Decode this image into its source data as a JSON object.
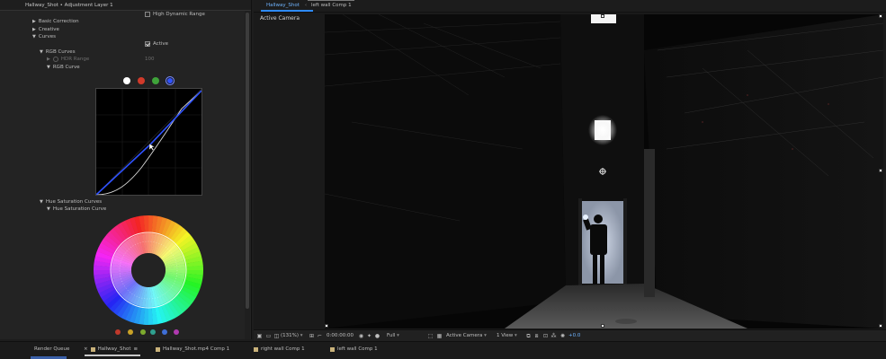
{
  "effect_controls": {
    "title": "Hallway_Shot • Adjustment Layer 1",
    "hdr_label": "High Dynamic Range",
    "basic_correction": "Basic Correction",
    "creative": "Creative",
    "curves": "Curves",
    "active_label": "Active",
    "rgb_curves": "RGB Curves",
    "hdr_range_label": "HDR Range",
    "hdr_range_value": "100",
    "rgb_curve": "RGB Curve",
    "hue_saturation_curves": "Hue Saturation Curves",
    "hue_saturation_curve": "Hue Saturation Curve",
    "channel_colors": [
      "#ffffff",
      "#d13a2a",
      "#3fa33a",
      "#2f52ff"
    ],
    "selected_channel": "blue",
    "swatch_colors": [
      "#c0392b",
      "#c9a227",
      "#7daa2e",
      "#2fa08f",
      "#3f6fd6",
      "#b03ab0"
    ]
  },
  "viewer": {
    "tabs": [
      "Hallway_Shot",
      "left wall Comp 1"
    ],
    "active_tab": "Hallway_Shot",
    "camera_label": "Active Camera"
  },
  "toolbar": {
    "zoom": "(131%)",
    "timecode": "0:00:00:00",
    "resolution": "Full",
    "camera": "Active Camera",
    "views": "1 View",
    "exposure": "+0.0"
  },
  "timeline_tabs": {
    "render_queue": "Render Queue",
    "hallway_shot": "Hallway_Shot",
    "hallway_mp4_comp": "Hallway_Shot.mp4 Comp 1",
    "right_wall_comp": "right wall Comp 1",
    "left_wall_comp": "left wall Comp 1",
    "swatch_color": "#c9b27a"
  }
}
